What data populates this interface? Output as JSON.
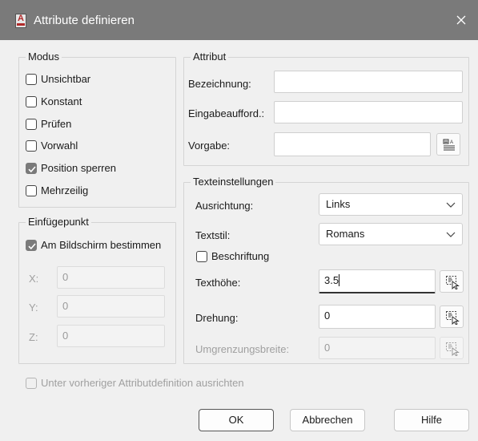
{
  "window": {
    "title": "Attribute definieren",
    "app_icon_letter": "A"
  },
  "modus": {
    "legend": "Modus",
    "options": [
      {
        "label": "Unsichtbar",
        "checked": false
      },
      {
        "label": "Konstant",
        "checked": false
      },
      {
        "label": "Prüfen",
        "checked": false
      },
      {
        "label": "Vorwahl",
        "checked": false
      },
      {
        "label": "Position sperren",
        "checked": true
      },
      {
        "label": "Mehrzeilig",
        "checked": false
      }
    ]
  },
  "einfuegepunkt": {
    "legend": "Einfügepunkt",
    "screen_label": "Am Bildschirm bestimmen",
    "screen_checked": true,
    "x_label": "X:",
    "x_value": "0",
    "y_label": "Y:",
    "y_value": "0",
    "z_label": "Z:",
    "z_value": "0"
  },
  "attribut": {
    "legend": "Attribut",
    "bezeichnung_label": "Bezeichnung:",
    "bezeichnung_value": "",
    "eingabe_label": "Eingabeaufford.:",
    "eingabe_value": "",
    "vorgabe_label": "Vorgabe:",
    "vorgabe_value": ""
  },
  "text": {
    "legend": "Texteinstellungen",
    "ausrichtung_label": "Ausrichtung:",
    "ausrichtung_value": "Links",
    "textstil_label": "Textstil:",
    "textstil_value": "Romans",
    "beschriftung_label": "Beschriftung",
    "beschriftung_checked": false,
    "texthoehe_label": "Texthöhe:",
    "texthoehe_value": "3.5",
    "drehung_label": "Drehung:",
    "drehung_value": "0",
    "umgrenzung_label": "Umgrenzungsbreite:",
    "umgrenzung_value": "0"
  },
  "align_prev": {
    "label": "Unter vorheriger Attributdefinition ausrichten",
    "checked": false
  },
  "buttons": {
    "ok": "OK",
    "cancel": "Abbrechen",
    "help": "Hilfe"
  }
}
